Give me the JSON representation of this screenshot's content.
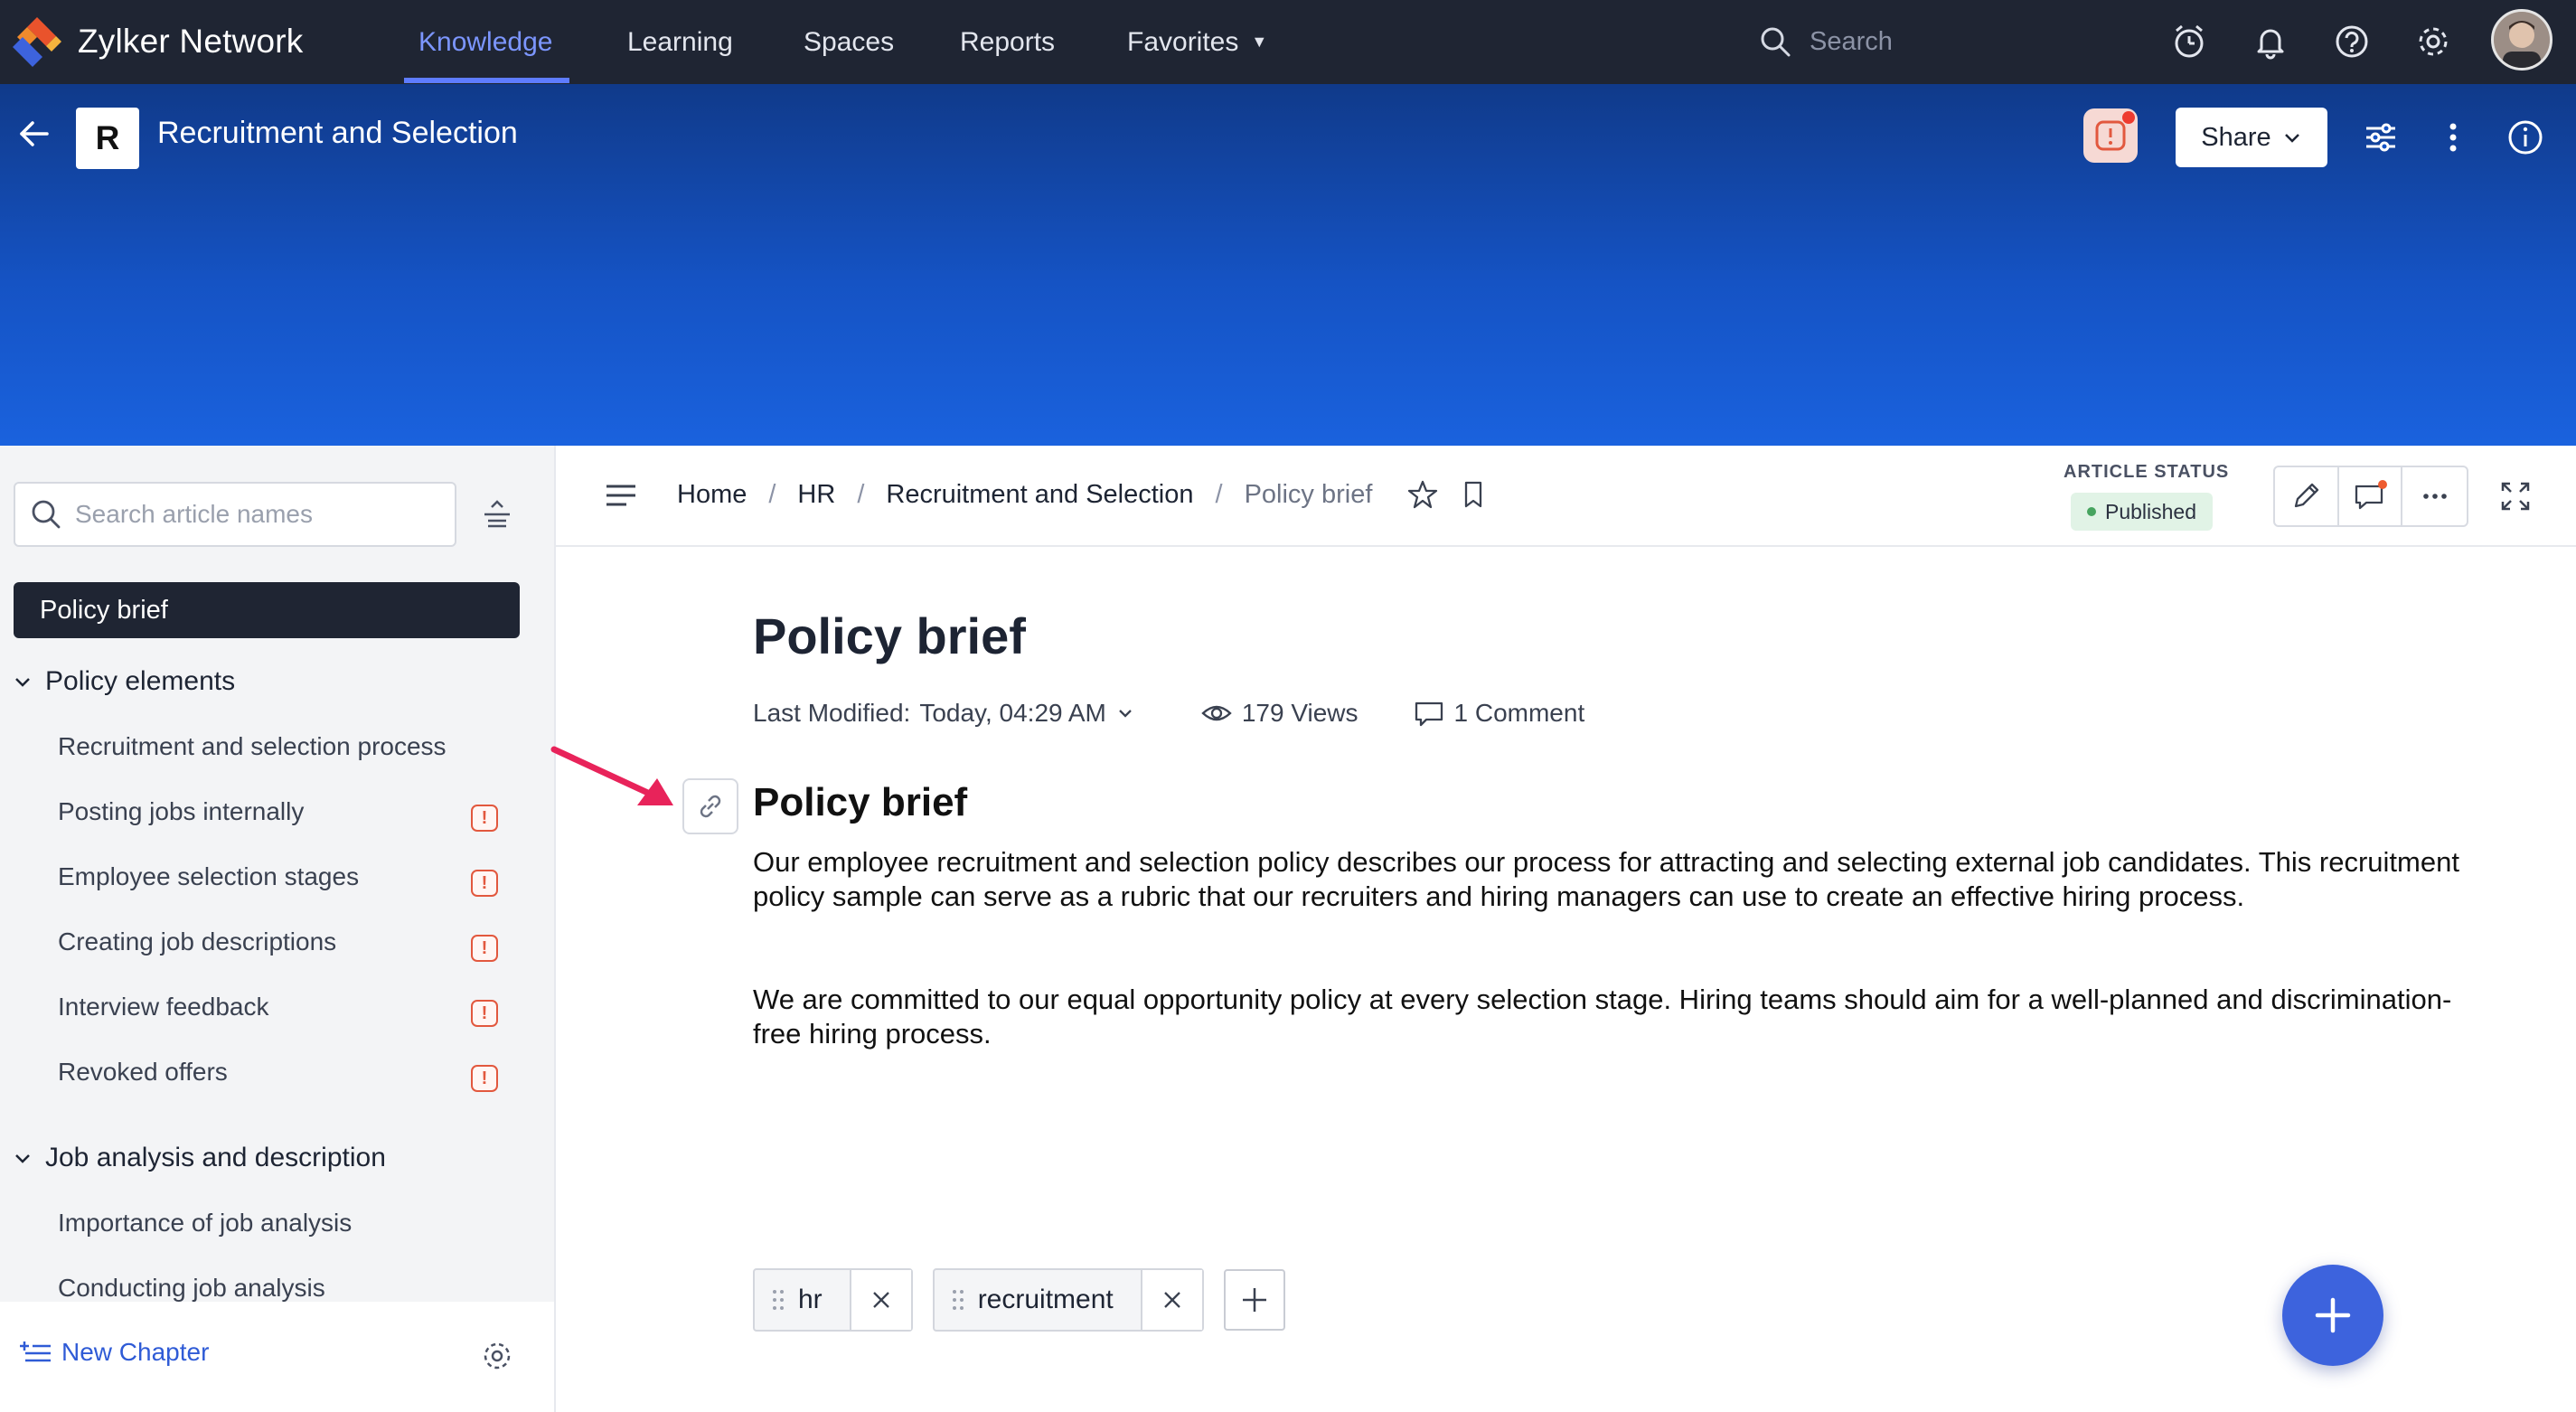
{
  "app": {
    "name": "Zylker Network"
  },
  "nav": {
    "items": [
      {
        "label": "Knowledge",
        "active": true
      },
      {
        "label": "Learning"
      },
      {
        "label": "Spaces"
      },
      {
        "label": "Reports"
      },
      {
        "label": "Favorites"
      }
    ],
    "search_placeholder": "Search"
  },
  "space": {
    "badge": "R",
    "title": "Recruitment and Selection"
  },
  "banner": {
    "share_label": "Share"
  },
  "sidebar": {
    "search_placeholder": "Search article names",
    "active_item": "Policy brief",
    "sections": [
      {
        "title": "Policy elements",
        "items": [
          {
            "label": "Recruitment and selection process",
            "warning": false
          },
          {
            "label": "Posting jobs internally",
            "warning": true
          },
          {
            "label": "Employee selection stages",
            "warning": true
          },
          {
            "label": "Creating job descriptions",
            "warning": true
          },
          {
            "label": "Interview feedback",
            "warning": true
          },
          {
            "label": "Revoked offers",
            "warning": true
          }
        ]
      },
      {
        "title": "Job analysis and description",
        "items": [
          {
            "label": "Importance of job analysis"
          },
          {
            "label": "Conducting job analysis"
          }
        ]
      }
    ],
    "new_chapter_label": "New Chapter",
    "warning_glyph": "!"
  },
  "breadcrumb": [
    "Home",
    "HR",
    "Recruitment and Selection",
    "Policy brief"
  ],
  "article_status": {
    "label": "ARTICLE STATUS",
    "value": "Published",
    "color": "#46a45f"
  },
  "article": {
    "title": "Policy brief",
    "last_modified_label": "Last Modified:",
    "last_modified_value": "Today, 04:29 AM",
    "views": "179 Views",
    "comments": "1 Comment",
    "heading": "Policy brief",
    "paragraphs": [
      "Our employee recruitment and selection policy describes our process for attracting and selecting external job candidates. This recruitment policy sample can serve as a rubric that our recruiters and hiring managers can use to create an effective hiring process.",
      "We are committed to our equal opportunity policy at every selection stage. Hiring teams should aim for a well-planned and discrimination-free hiring process."
    ]
  },
  "tags": [
    "hr",
    "recruitment"
  ],
  "colors": {
    "nav_bg": "#1f2533",
    "accent": "#5e7cff",
    "banner": "#1553c4",
    "fab": "#3d63dd",
    "annotation_arrow": "#e8235a"
  }
}
